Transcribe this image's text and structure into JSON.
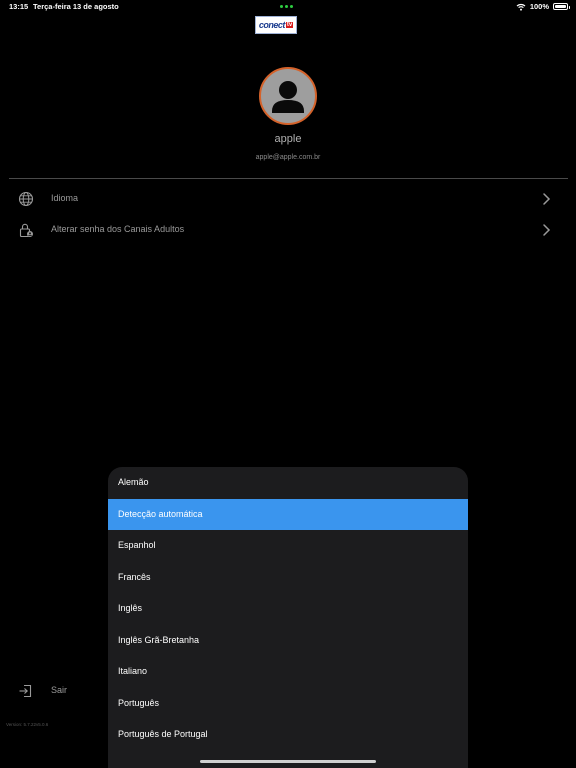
{
  "status_bar": {
    "time": "13:15",
    "date": "Terça-feira 13 de agosto",
    "battery": "100%"
  },
  "header": {
    "logo_text": "conect",
    "logo_badge": "tv"
  },
  "profile": {
    "name": "apple",
    "email": "apple@apple.com.br"
  },
  "menu": {
    "items": [
      {
        "label": "Idioma",
        "icon": "globe-icon"
      },
      {
        "label": "Alterar senha dos Canais Adultos",
        "icon": "lock-icon"
      }
    ]
  },
  "logout": {
    "label": "Sair",
    "icon": "logout-icon"
  },
  "version": "Version: 5.7.22v5.0.6",
  "language_sheet": {
    "options": [
      "Alemão",
      "Detecção automática",
      "Espanhol",
      "Francês",
      "Inglês",
      "Inglês Grã-Bretanha",
      "Italiano",
      "Português",
      "Português de Portugal"
    ],
    "selected": "Detecção automática"
  },
  "colors": {
    "background": "#000000",
    "accent": "#3a95ee",
    "avatar_ring": "#d4622a",
    "sheet_bg": "#1c1c1e"
  }
}
